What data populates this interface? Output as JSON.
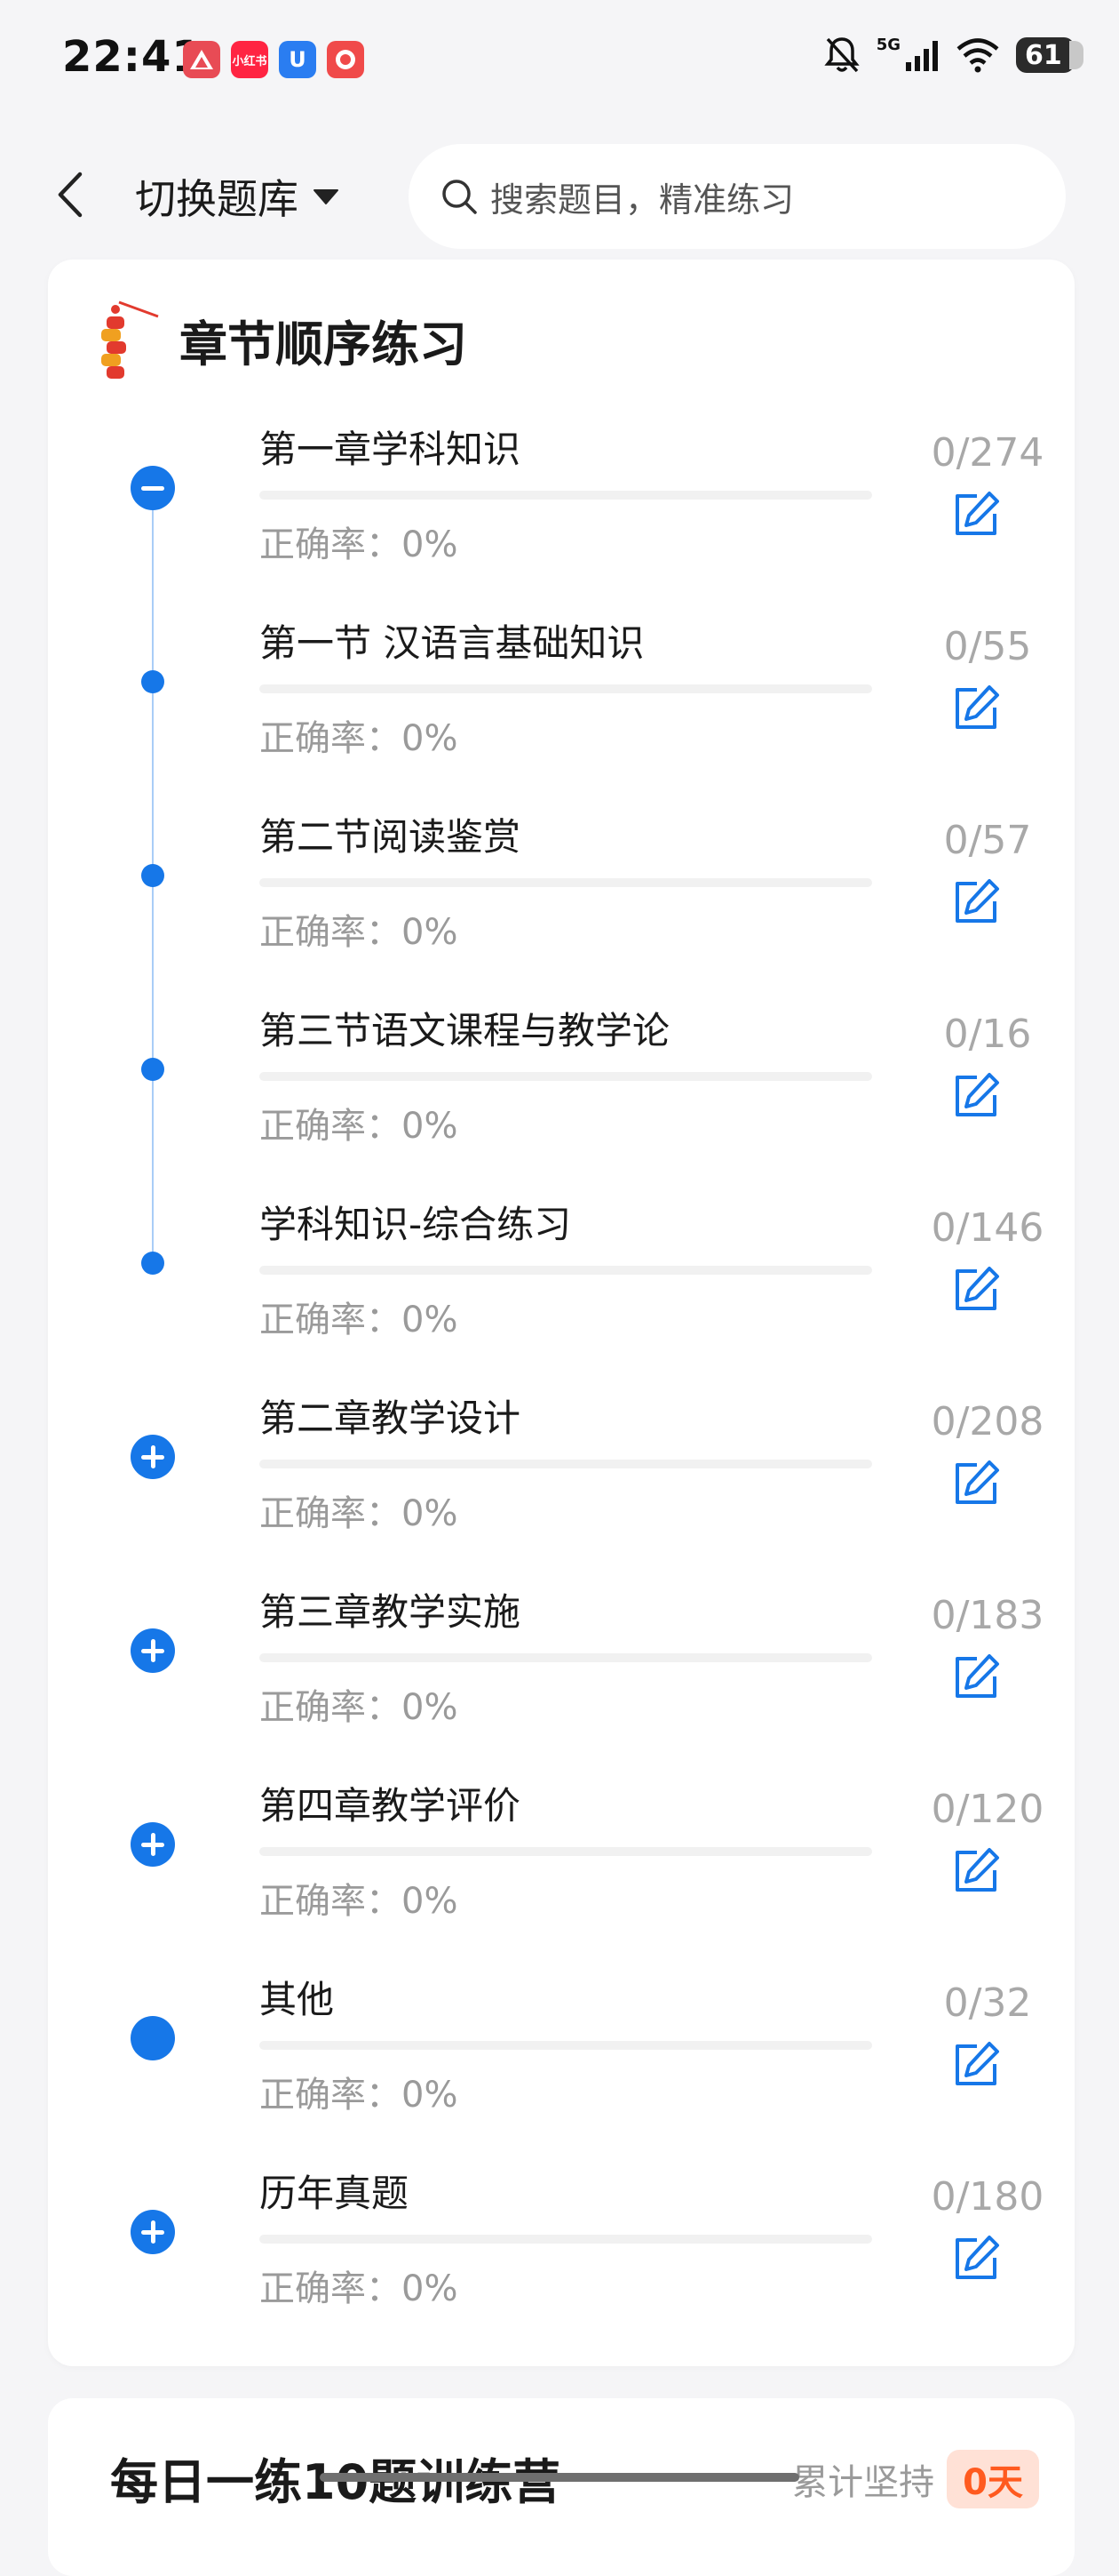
{
  "status_bar": {
    "time": "22:41",
    "network": "5G",
    "battery": "61",
    "app_icons": [
      {
        "name": "app-icon-1",
        "color": "#e84b55",
        "label": ""
      },
      {
        "name": "xiaohongshu-icon",
        "color": "#ff2442",
        "label": "小红书"
      },
      {
        "name": "app-icon-3",
        "color": "#2a7df1",
        "label": "U"
      },
      {
        "name": "app-icon-4",
        "color": "#f04a4a",
        "label": ""
      }
    ]
  },
  "header": {
    "bank_switch_label": "切换题库",
    "search_placeholder": "搜索题目，精准练习"
  },
  "section": {
    "title": "章节顺序练习",
    "chapters": [
      {
        "name": "第一章学科知识",
        "count": "0/274",
        "accuracy": "正确率：0%",
        "node": "minus"
      },
      {
        "name": "第一节 汉语言基础知识",
        "count": "0/55",
        "accuracy": "正确率：0%",
        "node": "dot"
      },
      {
        "name": "第二节阅读鉴赏",
        "count": "0/57",
        "accuracy": "正确率：0%",
        "node": "dot"
      },
      {
        "name": "第三节语文课程与教学论",
        "count": "0/16",
        "accuracy": "正确率：0%",
        "node": "dot"
      },
      {
        "name": "学科知识-综合练习",
        "count": "0/146",
        "accuracy": "正确率：0%",
        "node": "dot"
      },
      {
        "name": "第二章教学设计",
        "count": "0/208",
        "accuracy": "正确率：0%",
        "node": "plus"
      },
      {
        "name": "第三章教学实施",
        "count": "0/183",
        "accuracy": "正确率：0%",
        "node": "plus"
      },
      {
        "name": "第四章教学评价",
        "count": "0/120",
        "accuracy": "正确率：0%",
        "node": "plus"
      },
      {
        "name": "其他",
        "count": "0/32",
        "accuracy": "正确率：0%",
        "node": "big"
      },
      {
        "name": "历年真题",
        "count": "0/180",
        "accuracy": "正确率：0%",
        "node": "plus"
      }
    ]
  },
  "daily": {
    "title": "每日一练10题训练营",
    "streak_label": "累计坚持",
    "streak_value": "0天"
  },
  "colors": {
    "accent": "#1677e8",
    "muted": "#9a9a9a",
    "streak": "#ff5a1f"
  }
}
